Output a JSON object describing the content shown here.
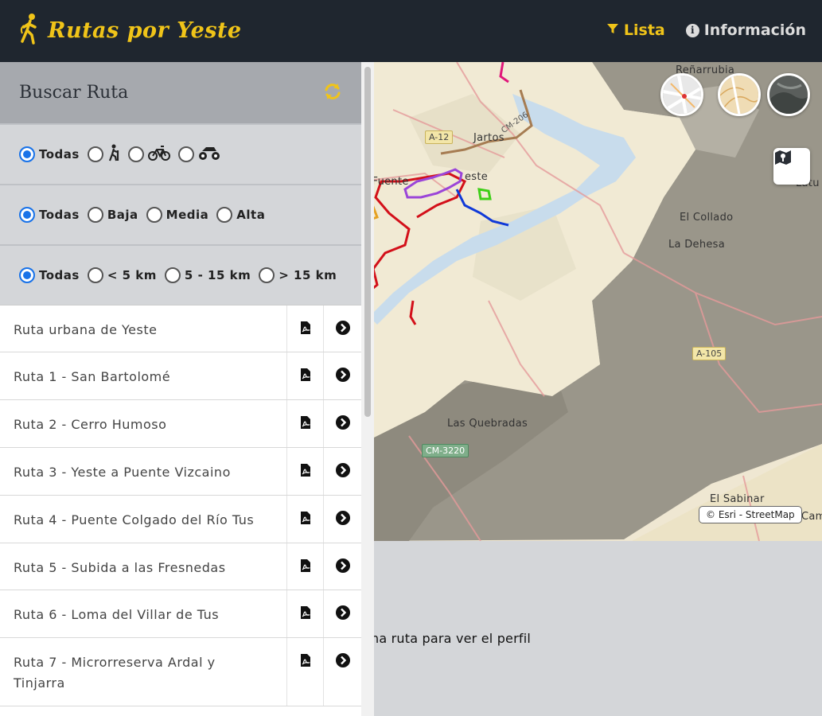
{
  "app": {
    "title": "Rutas por Yeste"
  },
  "nav": {
    "lista": "Lista",
    "informacion": "Información"
  },
  "panel": {
    "title": "Buscar Ruta",
    "filters": {
      "type": {
        "todas": "Todas"
      },
      "difficulty": {
        "todas": "Todas",
        "baja": "Baja",
        "media": "Media",
        "alta": "Alta"
      },
      "distance": {
        "todas": "Todas",
        "lt5": "< 5 km",
        "mid": "5 - 15 km",
        "gt15": "> 15 km"
      }
    },
    "routes": [
      "Ruta urbana de Yeste",
      "Ruta 1 - San Bartolomé",
      "Ruta 2 - Cerro Humoso",
      "Ruta 3 - Yeste a Puente Vizcaino",
      "Ruta 4 - Puente Colgado del Río Tus",
      "Ruta 5 - Subida a las Fresnedas",
      "Ruta 6 - Loma del Villar de Tus",
      "Ruta 7 - Microrreserva Ardal y Tinjarra"
    ]
  },
  "map": {
    "labels": {
      "renarrubia": "Reñarrubia",
      "jartos": "Jartos",
      "fuente": "s Fuente",
      "yeste": "este",
      "collado": "El Collado",
      "dehesa": "La Dehesa",
      "quebradas": "Las Quebradas",
      "sabinar": "El Sabinar",
      "latu": "Latu",
      "camp": "Camp"
    },
    "roads": {
      "a12": "A-12",
      "cm": "CM-206",
      "a105": "A-105",
      "cm3220": "CM-3220"
    },
    "attribution": "© Esri - StreetMap"
  },
  "profile": {
    "hint": "na ruta para ver el perfil"
  }
}
